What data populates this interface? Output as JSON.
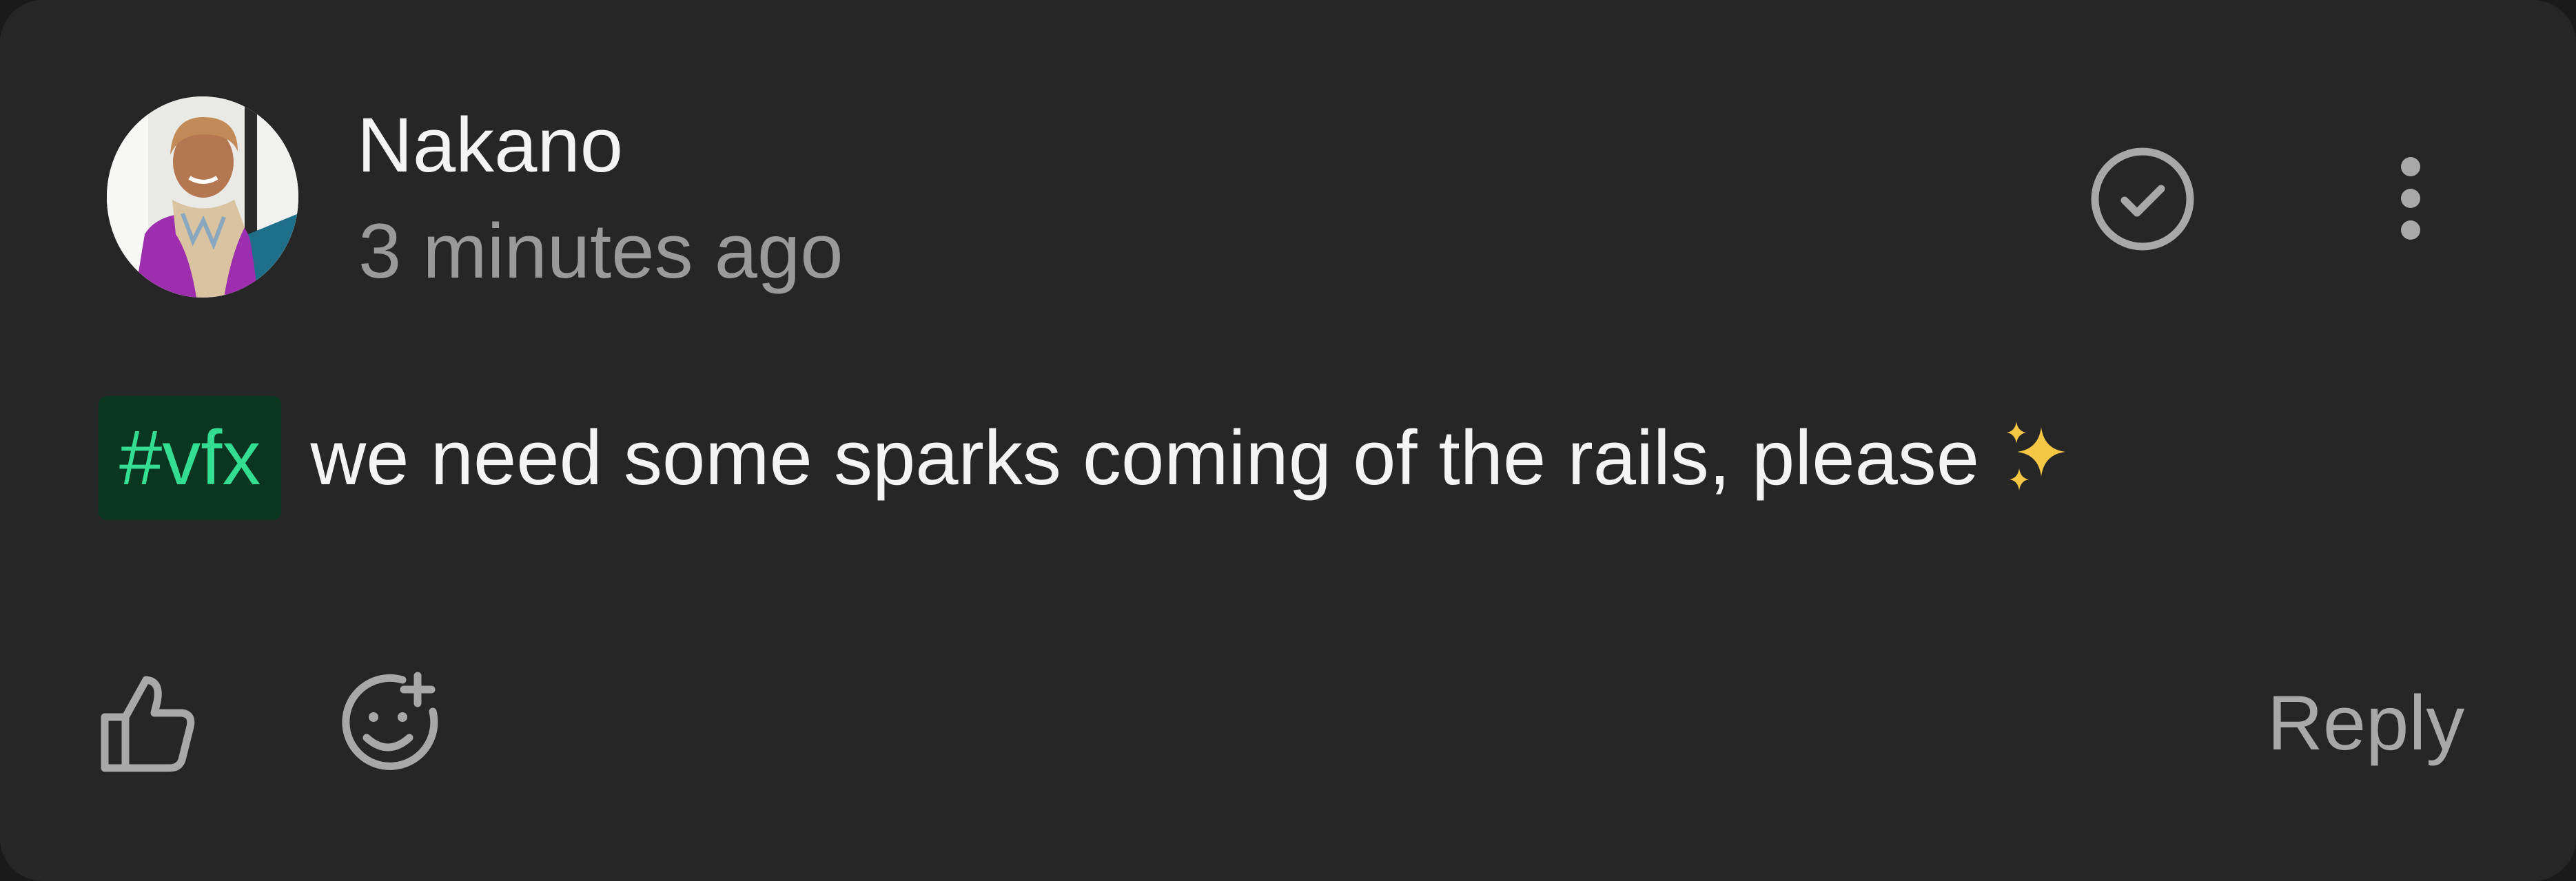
{
  "comment": {
    "author": "Nakano",
    "timestamp": "3 minutes ago",
    "tag": "#vfx",
    "message": "we need some sparks coming of the rails, please",
    "emoji_icon": "sparkles-icon"
  },
  "actions": {
    "resolve_icon": "check-circle-icon",
    "more_icon": "more-vertical-icon",
    "like_icon": "thumbs-up-icon",
    "add_reaction_icon": "emoji-add-icon",
    "reply_label": "Reply"
  },
  "colors": {
    "card_background": "#262626",
    "text_primary": "#f4f4f4",
    "text_secondary": "#9a9a9a",
    "tag_background": "#0a3620",
    "tag_text": "#33dd92",
    "icon": "#a8a8a8",
    "sparkle": "#f6c744"
  }
}
